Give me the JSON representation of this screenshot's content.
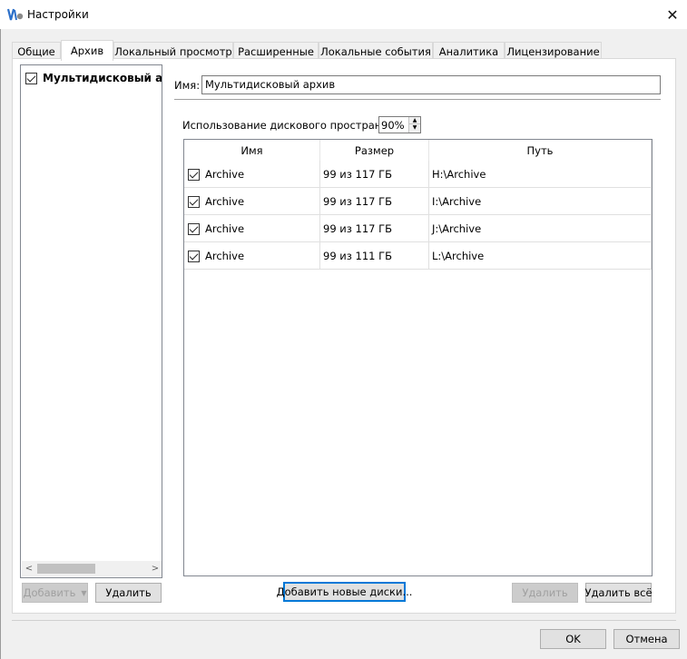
{
  "window": {
    "title": "Настройки",
    "close_glyph": "✕"
  },
  "tabs": [
    {
      "label": "Общие",
      "active": false
    },
    {
      "label": "Архив",
      "active": true
    },
    {
      "label": "Локальный просмотр",
      "active": false
    },
    {
      "label": "Расширенные",
      "active": false
    },
    {
      "label": "Локальные события",
      "active": false
    },
    {
      "label": "Аналитика",
      "active": false
    },
    {
      "label": "Лицензирование",
      "active": false
    }
  ],
  "archive_list": {
    "items": [
      {
        "label": "Мультидисковый архив",
        "checked": true
      }
    ],
    "scroll_left": "<",
    "scroll_right": ">"
  },
  "left_buttons": {
    "add": "Добавить",
    "delete": "Удалить"
  },
  "form": {
    "name_label": "Имя:",
    "name_value": "Мультидисковый архив",
    "usage_label": "Использование дискового пространства:",
    "usage_value": "90%"
  },
  "disks": {
    "columns": [
      "Имя",
      "Размер",
      "Путь"
    ],
    "rows": [
      {
        "checked": true,
        "name": "Archive",
        "size": "99 из 117 ГБ",
        "path": "H:\\Archive"
      },
      {
        "checked": true,
        "name": "Archive",
        "size": "99 из 117 ГБ",
        "path": "I:\\Archive"
      },
      {
        "checked": true,
        "name": "Archive",
        "size": "99 из 117 ГБ",
        "path": "J:\\Archive"
      },
      {
        "checked": true,
        "name": "Archive",
        "size": "99 из 111 ГБ",
        "path": "L:\\Archive"
      }
    ]
  },
  "disk_buttons": {
    "add_new": "Добавить новые диски...",
    "delete": "Удалить",
    "delete_all": "Удалить всё"
  },
  "dialog_buttons": {
    "ok": "OK",
    "cancel": "Отмена"
  },
  "colors": {
    "accent": "#0078d7",
    "window_bg": "#f0f0f0",
    "disabled_bg": "#cccccc"
  },
  "icons": {
    "app": "app-logo-icon",
    "close": "close-icon",
    "checkbox": "checkbox-checked-icon"
  }
}
